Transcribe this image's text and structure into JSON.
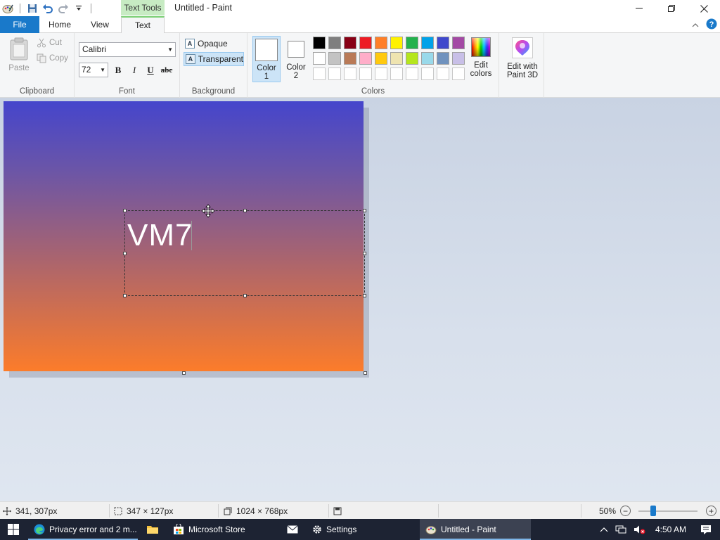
{
  "window": {
    "title": "Untitled - Paint",
    "context_tab": "Text Tools"
  },
  "tabs": {
    "file": "File",
    "home": "Home",
    "view": "View",
    "text": "Text"
  },
  "ribbon": {
    "clipboard": {
      "paste": "Paste",
      "cut": "Cut",
      "copy": "Copy",
      "group_label": "Clipboard"
    },
    "font": {
      "family": "Calibri",
      "size": "72",
      "bold": "B",
      "italic": "I",
      "underline": "U",
      "strikethrough": "abc",
      "group_label": "Font"
    },
    "background": {
      "opaque": "Opaque",
      "transparent": "Transparent",
      "selected": "transparent",
      "group_label": "Background"
    },
    "colors": {
      "color1_line1": "Color",
      "color1_line2": "1",
      "color2_line1": "Color",
      "color2_line2": "2",
      "color1_value": "#ffffff",
      "color2_value": "#ffffff",
      "edit_colors_line1": "Edit",
      "edit_colors_line2": "colors",
      "group_label": "Colors",
      "palette": [
        "#000000",
        "#7f7f7f",
        "#880015",
        "#ed1c24",
        "#ff7f27",
        "#fff200",
        "#22b14c",
        "#00a2e8",
        "#3f48cc",
        "#a349a4",
        "#ffffff",
        "#c3c3c3",
        "#b97a57",
        "#ffaec9",
        "#ffc90e",
        "#efe4b0",
        "#b5e61d",
        "#99d9ea",
        "#7092be",
        "#c8bfe7",
        "#ffffff",
        "#ffffff",
        "#ffffff",
        "#ffffff",
        "#ffffff",
        "#ffffff",
        "#ffffff",
        "#ffffff",
        "#ffffff",
        "#ffffff"
      ]
    },
    "paint3d": {
      "line1": "Edit with",
      "line2": "Paint 3D"
    }
  },
  "canvas": {
    "text": "VM7",
    "gradient_top": "#4545cc",
    "gradient_bottom": "#fc7c2a",
    "text_color": "#ffffff"
  },
  "status": {
    "cursor_pos": "341, 307px",
    "selection_size": "347 × 127px",
    "image_size": "1024 × 768px",
    "zoom": "50%",
    "zoom_level": 0.25
  },
  "taskbar": {
    "apps": [
      {
        "label": "Privacy error and 2 m...",
        "icon": "edge-icon"
      },
      {
        "label": "",
        "icon": "file-explorer-icon"
      },
      {
        "label": "Microsoft Store",
        "icon": "store-icon"
      },
      {
        "label": "",
        "icon": "mail-icon"
      },
      {
        "label": "Settings",
        "icon": "settings-icon"
      },
      {
        "label": "Untitled - Paint",
        "icon": "paint-icon"
      }
    ],
    "clock": "4:50 AM"
  },
  "colors": {
    "accent": "#1979ca",
    "text_tools_tab": "#c7ebc3",
    "taskbar": "#1d2333"
  }
}
